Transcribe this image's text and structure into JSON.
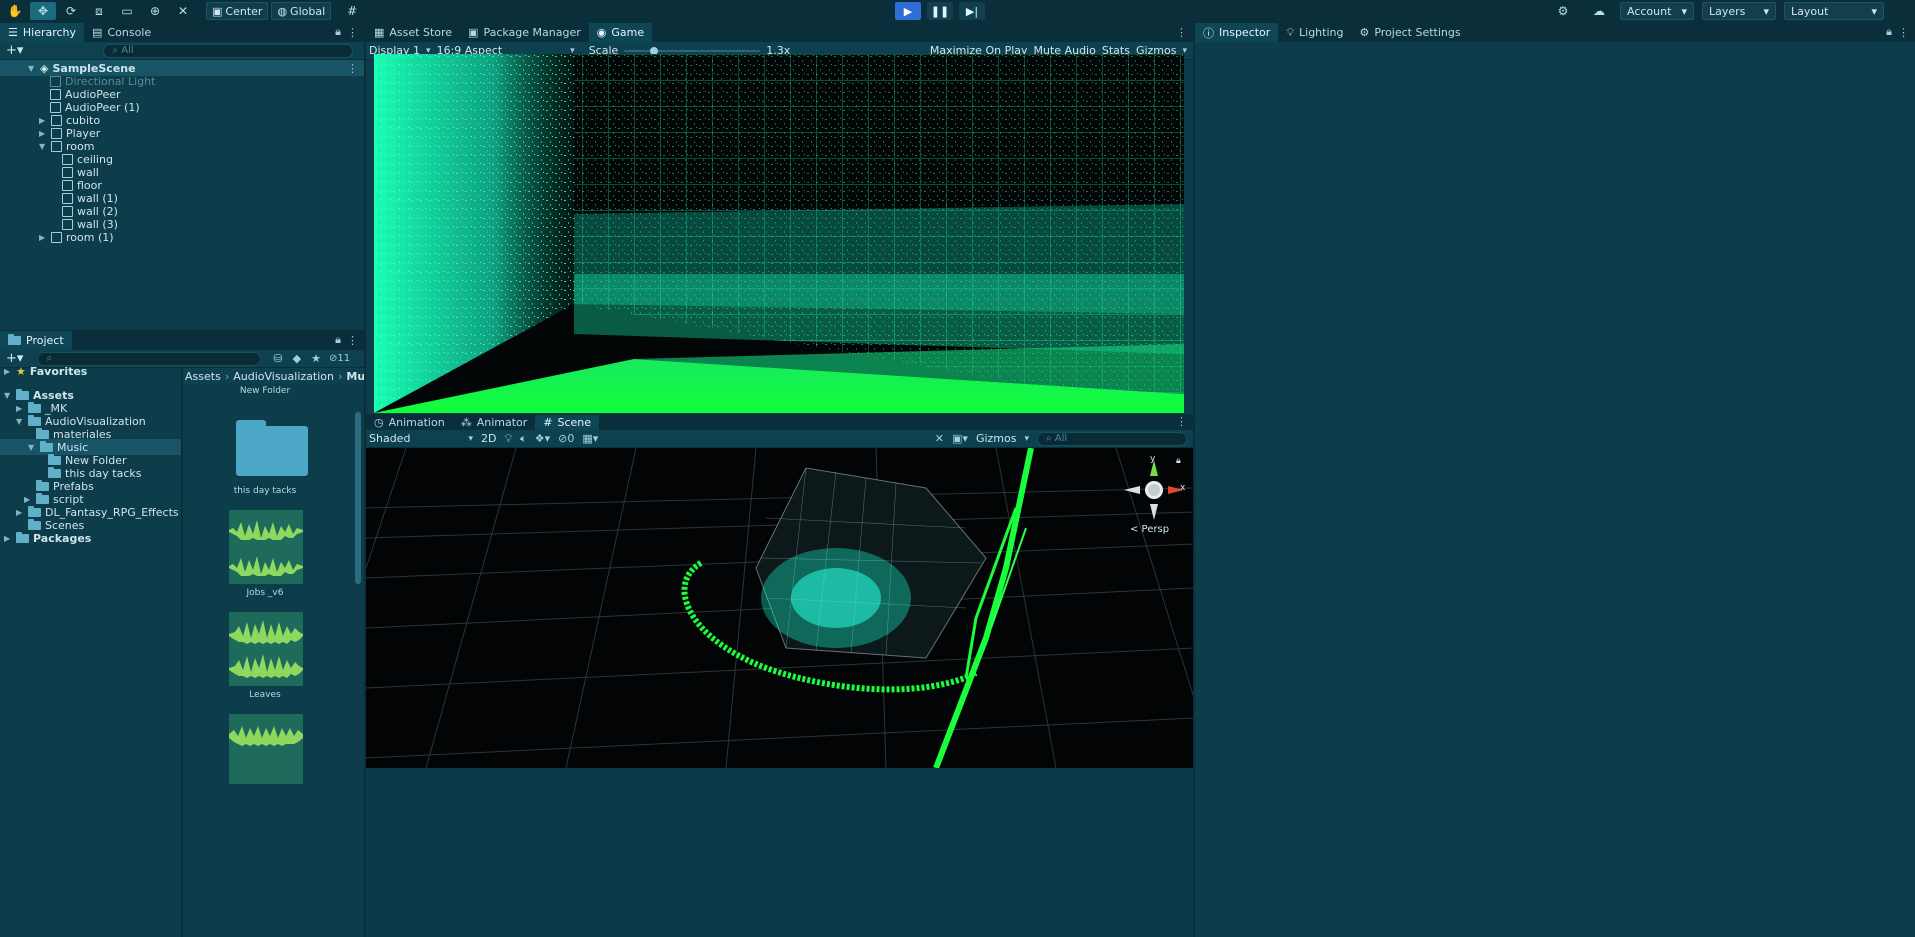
{
  "toolbar": {
    "pivot_label": "Center",
    "space_label": "Global",
    "account_label": "Account",
    "layers_label": "Layers",
    "layout_label": "Layout"
  },
  "hierarchy": {
    "tabs": [
      "Hierarchy",
      "Console"
    ],
    "search_placeholder": "All",
    "scene_name": "SampleScene",
    "items": [
      {
        "label": "Directional Light",
        "disabled": true
      },
      {
        "label": "AudioPeer"
      },
      {
        "label": "AudioPeer (1)"
      },
      {
        "label": "cubito"
      },
      {
        "label": "Player"
      },
      {
        "label": "room"
      },
      {
        "label": "ceiling"
      },
      {
        "label": "wall"
      },
      {
        "label": "floor"
      },
      {
        "label": "wall (1)"
      },
      {
        "label": "wall (2)"
      },
      {
        "label": "wall (3)"
      },
      {
        "label": "room (1)"
      }
    ]
  },
  "project": {
    "tab": "Project",
    "hidden_count": "11",
    "favorites": "Favorites",
    "tree": [
      {
        "label": "Assets"
      },
      {
        "label": "_MK"
      },
      {
        "label": "AudioVisualization"
      },
      {
        "label": "materiales"
      },
      {
        "label": "Music"
      },
      {
        "label": "New Folder"
      },
      {
        "label": "this day tacks"
      },
      {
        "label": "Prefabs"
      },
      {
        "label": "script"
      },
      {
        "label": "DL_Fantasy_RPG_Effects"
      },
      {
        "label": "Scenes"
      },
      {
        "label": "Packages"
      }
    ],
    "breadcrumb": [
      "Assets",
      "AudioVisualization",
      "Music"
    ],
    "grid_items": [
      {
        "label": "New Folder"
      },
      {
        "label": "this day tacks"
      },
      {
        "label": "Jobs _v6"
      },
      {
        "label": "Leaves"
      }
    ]
  },
  "center_top": {
    "tabs": [
      "Asset Store",
      "Package Manager",
      "Game"
    ],
    "display": "Display 1",
    "aspect": "16:9 Aspect",
    "scale_label": "Scale",
    "scale_value": "1.3x",
    "scale_fraction": 0.2,
    "maximize": "Maximize On Play",
    "mute": "Mute Audio",
    "stats": "Stats",
    "gizmos": "Gizmos"
  },
  "center_bottom": {
    "tabs": [
      "Animation",
      "Animator",
      "Scene"
    ],
    "shading": "Shaded",
    "mode_2d": "2D",
    "hidden_count": "0",
    "gizmos": "Gizmos",
    "search_placeholder": "All",
    "persp_label": "< Persp",
    "axis_y": "y",
    "axis_x": "x"
  },
  "inspector": {
    "tabs": [
      "Inspector",
      "Lighting",
      "Project Settings"
    ]
  },
  "colors": {
    "accent": "#2d6fd6",
    "neon_green": "#19ff3c",
    "cyan": "#1affd6"
  }
}
